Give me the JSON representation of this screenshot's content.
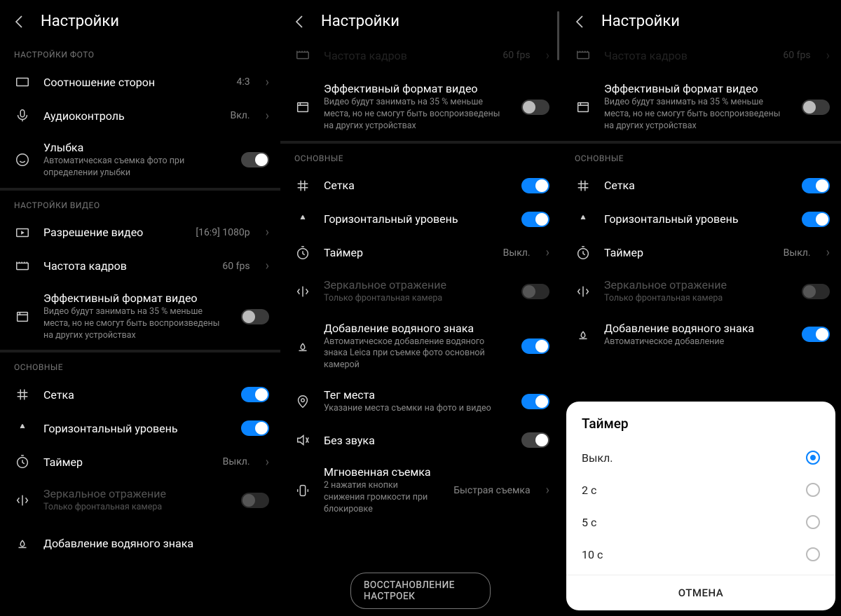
{
  "header": {
    "title": "Настройки"
  },
  "screen1": {
    "sec_photo": "НАСТРОЙКИ ФОТО",
    "aspect": {
      "label": "Соотношение сторон",
      "value": "4:3"
    },
    "audio": {
      "label": "Аудиоконтроль",
      "value": "Вкл."
    },
    "smile": {
      "label": "Улыбка",
      "sub": "Автоматическая съемка фото при определении улыбки"
    },
    "sec_video": "НАСТРОЙКИ ВИДЕО",
    "vres": {
      "label": "Разрешение видео",
      "value": "[16:9] 1080p"
    },
    "fps": {
      "label": "Частота кадров",
      "value": "60 fps"
    },
    "eff": {
      "label": "Эффективный формат видео",
      "sub": "Видео будут занимать на 35 % меньше места, но не смогут быть воспроизведены на других устройствах"
    },
    "sec_main": "ОСНОВНЫЕ",
    "grid": {
      "label": "Сетка"
    },
    "level": {
      "label": "Горизонтальный уровень"
    },
    "timer": {
      "label": "Таймер",
      "value": "Выкл."
    },
    "mirror": {
      "label": "Зеркальное отражение",
      "sub": "Только фронтальная камера"
    },
    "watermark": {
      "label": "Добавление водяного знака"
    }
  },
  "screen2": {
    "fps_cut": {
      "label": "Частота кадров",
      "value": "60 fps"
    },
    "eff": {
      "label": "Эффективный формат видео",
      "sub": "Видео будут занимать на 35 % меньше места, но не смогут быть воспроизведены на других устройствах"
    },
    "sec_main": "ОСНОВНЫЕ",
    "grid": {
      "label": "Сетка"
    },
    "level": {
      "label": "Горизонтальный уровень"
    },
    "timer": {
      "label": "Таймер",
      "value": "Выкл."
    },
    "mirror": {
      "label": "Зеркальное отражение",
      "sub": "Только фронтальная камера"
    },
    "watermark": {
      "label": "Добавление водяного знака",
      "sub": "Автоматическое добавление водяного знака Leica при съемке фото основной камерой"
    },
    "geo": {
      "label": "Тег места",
      "sub": "Указание места съемки на фото и видео"
    },
    "mute": {
      "label": "Без звука"
    },
    "instant": {
      "label": "Мгновенная съемка",
      "sub": "2 нажатия кнопки снижения громкости при блокировке",
      "value": "Быстрая съемка"
    },
    "restore": "ВОССТАНОВЛЕНИЕ НАСТРОЕК"
  },
  "screen3": {
    "fps_cut": {
      "label": "Частота кадров",
      "value": "60 fps"
    },
    "eff": {
      "label": "Эффективный формат видео",
      "sub": "Видео будут занимать на 35 % меньше места, но не смогут быть воспроизведены на других устройствах"
    },
    "sec_main": "ОСНОВНЫЕ",
    "grid": {
      "label": "Сетка"
    },
    "level": {
      "label": "Горизонтальный уровень"
    },
    "timer": {
      "label": "Таймер",
      "value": "Выкл."
    },
    "mirror": {
      "label": "Зеркальное отражение",
      "sub": "Только фронтальная камера"
    },
    "watermark": {
      "label": "Добавление водяного знака",
      "sub": "Автоматическое добавление"
    },
    "sheet": {
      "title": "Таймер",
      "options": [
        "Выкл.",
        "2 с",
        "5 с",
        "10 с"
      ],
      "cancel": "ОТМЕНА"
    }
  }
}
